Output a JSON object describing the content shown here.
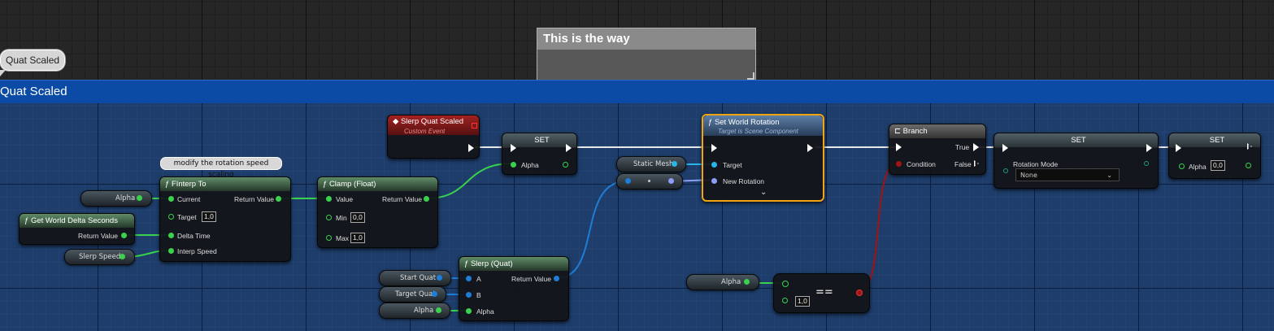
{
  "graph": {
    "comment_bubble": "Quat Scaled",
    "comment_group_title": "Quat Scaled",
    "comment_box_title": "This is the way",
    "node_tooltip": "modify the rotation speed scaling"
  },
  "nodes": {
    "alpha_var": "Alpha",
    "get_world_delta": {
      "title": "Get World Delta Seconds",
      "return_value": "Return Value"
    },
    "slerp_speed_var": "Slerp Speed",
    "finterp": {
      "title": "FInterp To",
      "current": "Current",
      "target": "Target",
      "target_value": "1,0",
      "delta_time": "Delta Time",
      "interp_speed": "Interp Speed",
      "return_value": "Return Value"
    },
    "clamp": {
      "title": "Clamp (Float)",
      "value": "Value",
      "min": "Min",
      "min_value": "0,0",
      "max": "Max",
      "max_value": "1,0",
      "return_value": "Return Value"
    },
    "event": {
      "title": "Slerp Quat Scaled",
      "subtitle": "Custom Event"
    },
    "set1": {
      "title": "SET",
      "alpha": "Alpha"
    },
    "static_mesh_var": "Static Mesh",
    "set_world_rotation": {
      "title": "Set World Rotation",
      "subtitle": "Target is Scene Component",
      "target": "Target",
      "new_rotation": "New Rotation"
    },
    "branch": {
      "title": "Branch",
      "condition": "Condition",
      "true": "True",
      "false": "False"
    },
    "set2": {
      "title": "SET",
      "rotation_mode": "Rotation Mode",
      "rotation_mode_value": "None"
    },
    "set3": {
      "title": "SET",
      "alpha": "Alpha",
      "alpha_value": "0,0"
    },
    "slerp_quat": {
      "title": "Slerp (Quat)",
      "a": "A",
      "b": "B",
      "alpha": "Alpha",
      "return_value": "Return Value"
    },
    "start_quat_var": "Start Quat",
    "target_quat_var": "Target Quat",
    "alpha_var2": "Alpha",
    "alpha_var3": "Alpha",
    "equal": {
      "symbol": "==",
      "b_value": "1,0"
    }
  }
}
